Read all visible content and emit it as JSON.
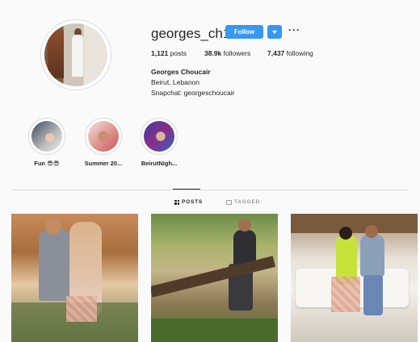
{
  "profile": {
    "username": "georges_ch1",
    "follow_label": "Follow",
    "more_label": "···",
    "full_name": "Georges Choucair",
    "bio_line1": "Beirut, Lebanon",
    "bio_line2": "Snapchat: georgeschoucair"
  },
  "stats": {
    "posts_count": "1,121",
    "posts_label": "posts",
    "followers_count": "38.9k",
    "followers_label": "followers",
    "following_count": "7,437",
    "following_label": "following"
  },
  "highlights": [
    {
      "label": "Fun 😎😎"
    },
    {
      "label": "Summer 20..."
    },
    {
      "label": "BeirutNigh..."
    }
  ],
  "tabs": {
    "posts_label": "POSTS",
    "tagged_label": "TAGGED"
  },
  "colors": {
    "accent": "#3897f0",
    "border": "#dbdbdb",
    "text": "#262626",
    "background": "#fafafa"
  }
}
